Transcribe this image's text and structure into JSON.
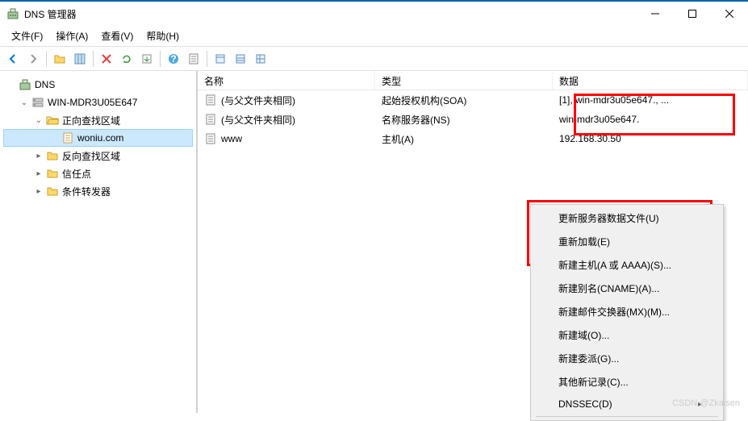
{
  "window": {
    "title": "DNS 管理器"
  },
  "menubar": {
    "items": [
      "文件(F)",
      "操作(A)",
      "查看(V)",
      "帮助(H)"
    ]
  },
  "tree": {
    "root": "DNS",
    "server": "WIN-MDR3U05E647",
    "forward_zone": "正向查找区域",
    "zone_name": "woniu.com",
    "reverse_zone": "反向查找区域",
    "trust_point": "信任点",
    "conditional_fwd": "条件转发器"
  },
  "list": {
    "headers": {
      "name": "名称",
      "type": "类型",
      "data": "数据"
    },
    "rows": [
      {
        "name": "(与父文件夹相同)",
        "type": "起始授权机构(SOA)",
        "data": "[1], win-mdr3u05e647., ..."
      },
      {
        "name": "(与父文件夹相同)",
        "type": "名称服务器(NS)",
        "data": "win-mdr3u05e647."
      },
      {
        "name": "www",
        "type": "主机(A)",
        "data": "192.168.30.50"
      }
    ]
  },
  "context_menu": {
    "update": "更新服务器数据文件(U)",
    "reload": "重新加载(E)",
    "new_host": "新建主机(A 或 AAAA)(S)...",
    "new_alias": "新建别名(CNAME)(A)...",
    "new_mx": "新建邮件交换器(MX)(M)...",
    "new_domain": "新建域(O)...",
    "new_delegation": "新建委派(G)...",
    "other_records": "其他新记录(C)...",
    "dnssec": "DNSSEC(D)"
  },
  "watermark": "CSDN @Zkaisen"
}
